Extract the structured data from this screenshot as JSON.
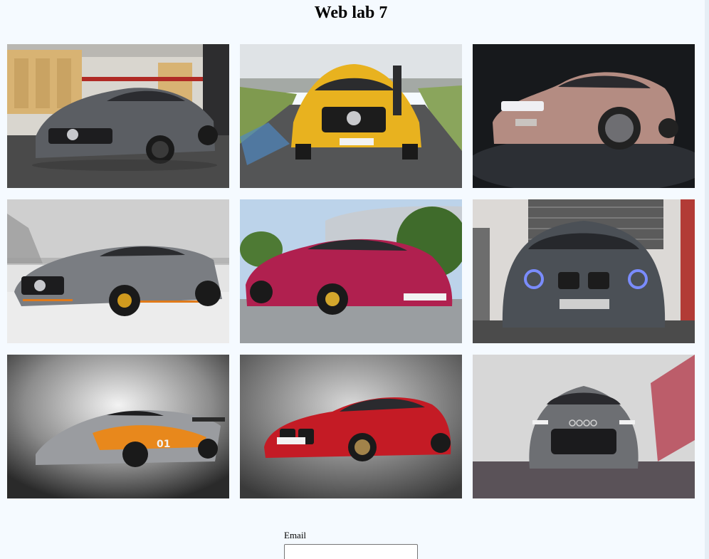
{
  "page": {
    "title": "Web lab 7"
  },
  "gallery": {
    "photos": [
      {
        "subject": "grey Mercedes-AMG GT R in a garage",
        "accent": "#5b5e63"
      },
      {
        "subject": "yellow Mercedes-AMG GT on a race track",
        "accent": "#e8b21f"
      },
      {
        "subject": "rose gold Porsche Taycan on dark background",
        "accent": "#b48c82"
      },
      {
        "subject": "grey Mercedes-AMG GT R with orange accents",
        "accent": "#7a7d82"
      },
      {
        "subject": "magenta Porsche Taycan outdoors",
        "accent": "#b0204f"
      },
      {
        "subject": "dark grey BMW with angel eye headlights",
        "accent": "#4b5056"
      },
      {
        "subject": "McLaren P1 GTR with orange livery",
        "accent": "#e8881c"
      },
      {
        "subject": "red BMW M4 coupe in studio",
        "accent": "#c41b25"
      },
      {
        "subject": "grey Audi RS6 in front of neon light",
        "accent": "#6d6f73"
      }
    ]
  },
  "form": {
    "email_label": "Email",
    "email_value": "",
    "email_placeholder": ""
  }
}
